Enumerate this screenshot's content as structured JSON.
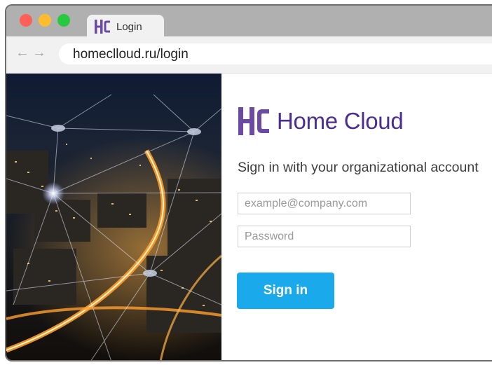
{
  "browser": {
    "tab": {
      "title": "Login",
      "icon": "home-cloud-logo-icon"
    },
    "address_bar": {
      "url": "homeclloud.ru/login"
    },
    "nav": {
      "back_icon": "arrow-left-icon",
      "forward_icon": "arrow-right-icon"
    },
    "colors": {
      "close": "#ff5f57",
      "minimize": "#ffbd2e",
      "maximize": "#28c940"
    }
  },
  "login": {
    "brand_name": "Home Cloud",
    "heading": "Sign in with your organizational account",
    "email_placeholder": "example@company.com",
    "password_placeholder": "Password",
    "signin_label": "Sign in",
    "colors": {
      "brand": "#4b2e8f",
      "button": "#1aa9ea"
    }
  }
}
